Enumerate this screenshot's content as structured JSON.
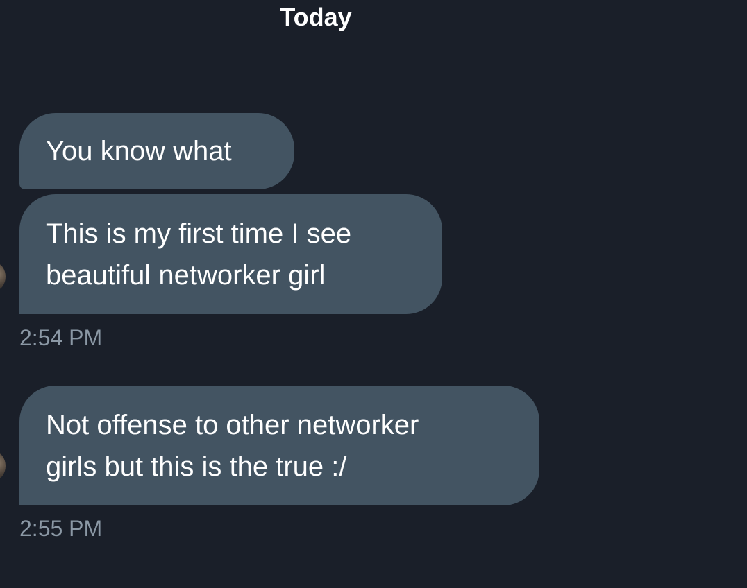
{
  "conversation": {
    "day_divider": "Today",
    "groups": [
      {
        "messages": [
          {
            "lines": [
              "You know what"
            ]
          },
          {
            "lines": [
              "This is my first time I see",
              "beautiful networker girl"
            ]
          }
        ],
        "timestamp": "2:54 PM"
      },
      {
        "messages": [
          {
            "lines": [
              "Not offense to other networker",
              "girls but this is the true :/"
            ]
          }
        ],
        "timestamp": "2:55 PM"
      }
    ]
  },
  "colors": {
    "background": "#1a1f29",
    "bubble": "#435462",
    "text": "#ffffff",
    "timestamp": "#8b98a5"
  }
}
